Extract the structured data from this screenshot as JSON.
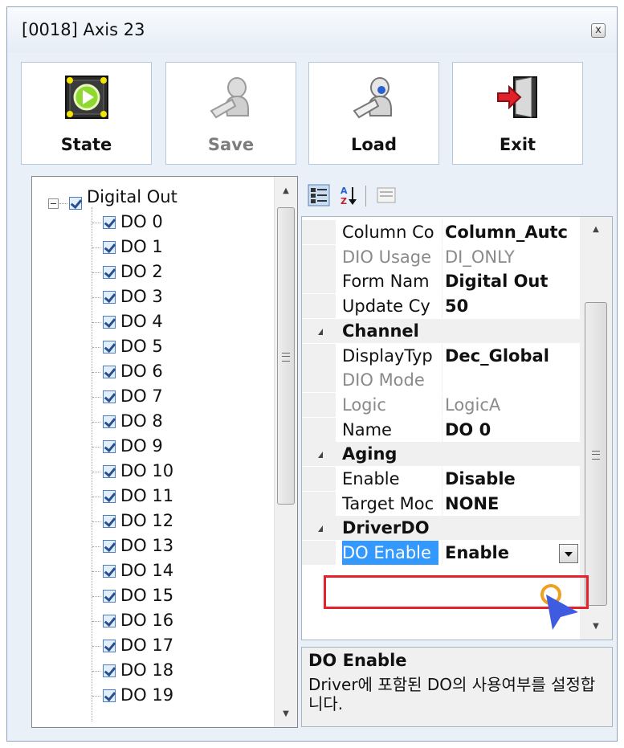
{
  "window": {
    "title": "[0018] Axis 23",
    "close_glyph": "x"
  },
  "toolbar": [
    {
      "label": "State",
      "icon": "state-icon",
      "enabled": true
    },
    {
      "label": "Save",
      "icon": "save-icon",
      "enabled": false
    },
    {
      "label": "Load",
      "icon": "load-icon",
      "enabled": true
    },
    {
      "label": "Exit",
      "icon": "exit-icon",
      "enabled": true
    }
  ],
  "tree": {
    "root": {
      "label": "Digital Out",
      "checked": true,
      "expanded": true
    },
    "items": [
      {
        "label": "DO 0",
        "checked": true
      },
      {
        "label": "DO 1",
        "checked": true
      },
      {
        "label": "DO 2",
        "checked": true
      },
      {
        "label": "DO 3",
        "checked": true
      },
      {
        "label": "DO 4",
        "checked": true
      },
      {
        "label": "DO 5",
        "checked": true
      },
      {
        "label": "DO 6",
        "checked": true
      },
      {
        "label": "DO 7",
        "checked": true
      },
      {
        "label": "DO 8",
        "checked": true
      },
      {
        "label": "DO 9",
        "checked": true
      },
      {
        "label": "DO 10",
        "checked": true
      },
      {
        "label": "DO 11",
        "checked": true
      },
      {
        "label": "DO 12",
        "checked": true
      },
      {
        "label": "DO 13",
        "checked": true
      },
      {
        "label": "DO 14",
        "checked": true
      },
      {
        "label": "DO 15",
        "checked": true
      },
      {
        "label": "DO 16",
        "checked": true
      },
      {
        "label": "DO 17",
        "checked": true
      },
      {
        "label": "DO 18",
        "checked": true
      },
      {
        "label": "DO 19",
        "checked": true
      }
    ]
  },
  "property_grid": {
    "toolbar": [
      "categorized-icon",
      "alphabetical-icon",
      "property-pages-icon"
    ],
    "rows": [
      {
        "kind": "prop",
        "name": "Column Co",
        "value": "Column_Autc",
        "bold": true,
        "dim": false
      },
      {
        "kind": "prop",
        "name": "DIO Usage",
        "value": "DI_ONLY",
        "bold": false,
        "dim": true
      },
      {
        "kind": "prop",
        "name": "Form Nam",
        "value": "Digital Out",
        "bold": true,
        "dim": false
      },
      {
        "kind": "prop",
        "name": "Update Cy",
        "value": "50",
        "bold": true,
        "dim": false
      },
      {
        "kind": "cat",
        "name": "Channel"
      },
      {
        "kind": "prop",
        "name": "DisplayTyp",
        "value": "Dec_Global",
        "bold": true,
        "dim": false
      },
      {
        "kind": "prop",
        "name": "DIO Mode",
        "value": "",
        "bold": false,
        "dim": true
      },
      {
        "kind": "prop",
        "name": "Logic",
        "value": "LogicA",
        "bold": false,
        "dim": true
      },
      {
        "kind": "prop",
        "name": "Name",
        "value": "DO 0",
        "bold": true,
        "dim": false
      },
      {
        "kind": "cat",
        "name": "Aging"
      },
      {
        "kind": "prop",
        "name": "Enable",
        "value": "Disable",
        "bold": true,
        "dim": false
      },
      {
        "kind": "prop",
        "name": "Target Moc",
        "value": "NONE",
        "bold": true,
        "dim": false
      },
      {
        "kind": "cat",
        "name": "DriverDO"
      },
      {
        "kind": "prop",
        "name": "DO Enable",
        "value": "Enable",
        "bold": true,
        "dim": false,
        "selected": true
      }
    ],
    "description": {
      "title": "DO Enable",
      "text": "Driver에 포함된 DO의 사용여부를 설정합니다."
    }
  },
  "colors": {
    "selection": "#3399ff",
    "highlight_border": "#e8202a",
    "cursor": "#3f5be0",
    "cursor_ring": "#f0a020"
  }
}
